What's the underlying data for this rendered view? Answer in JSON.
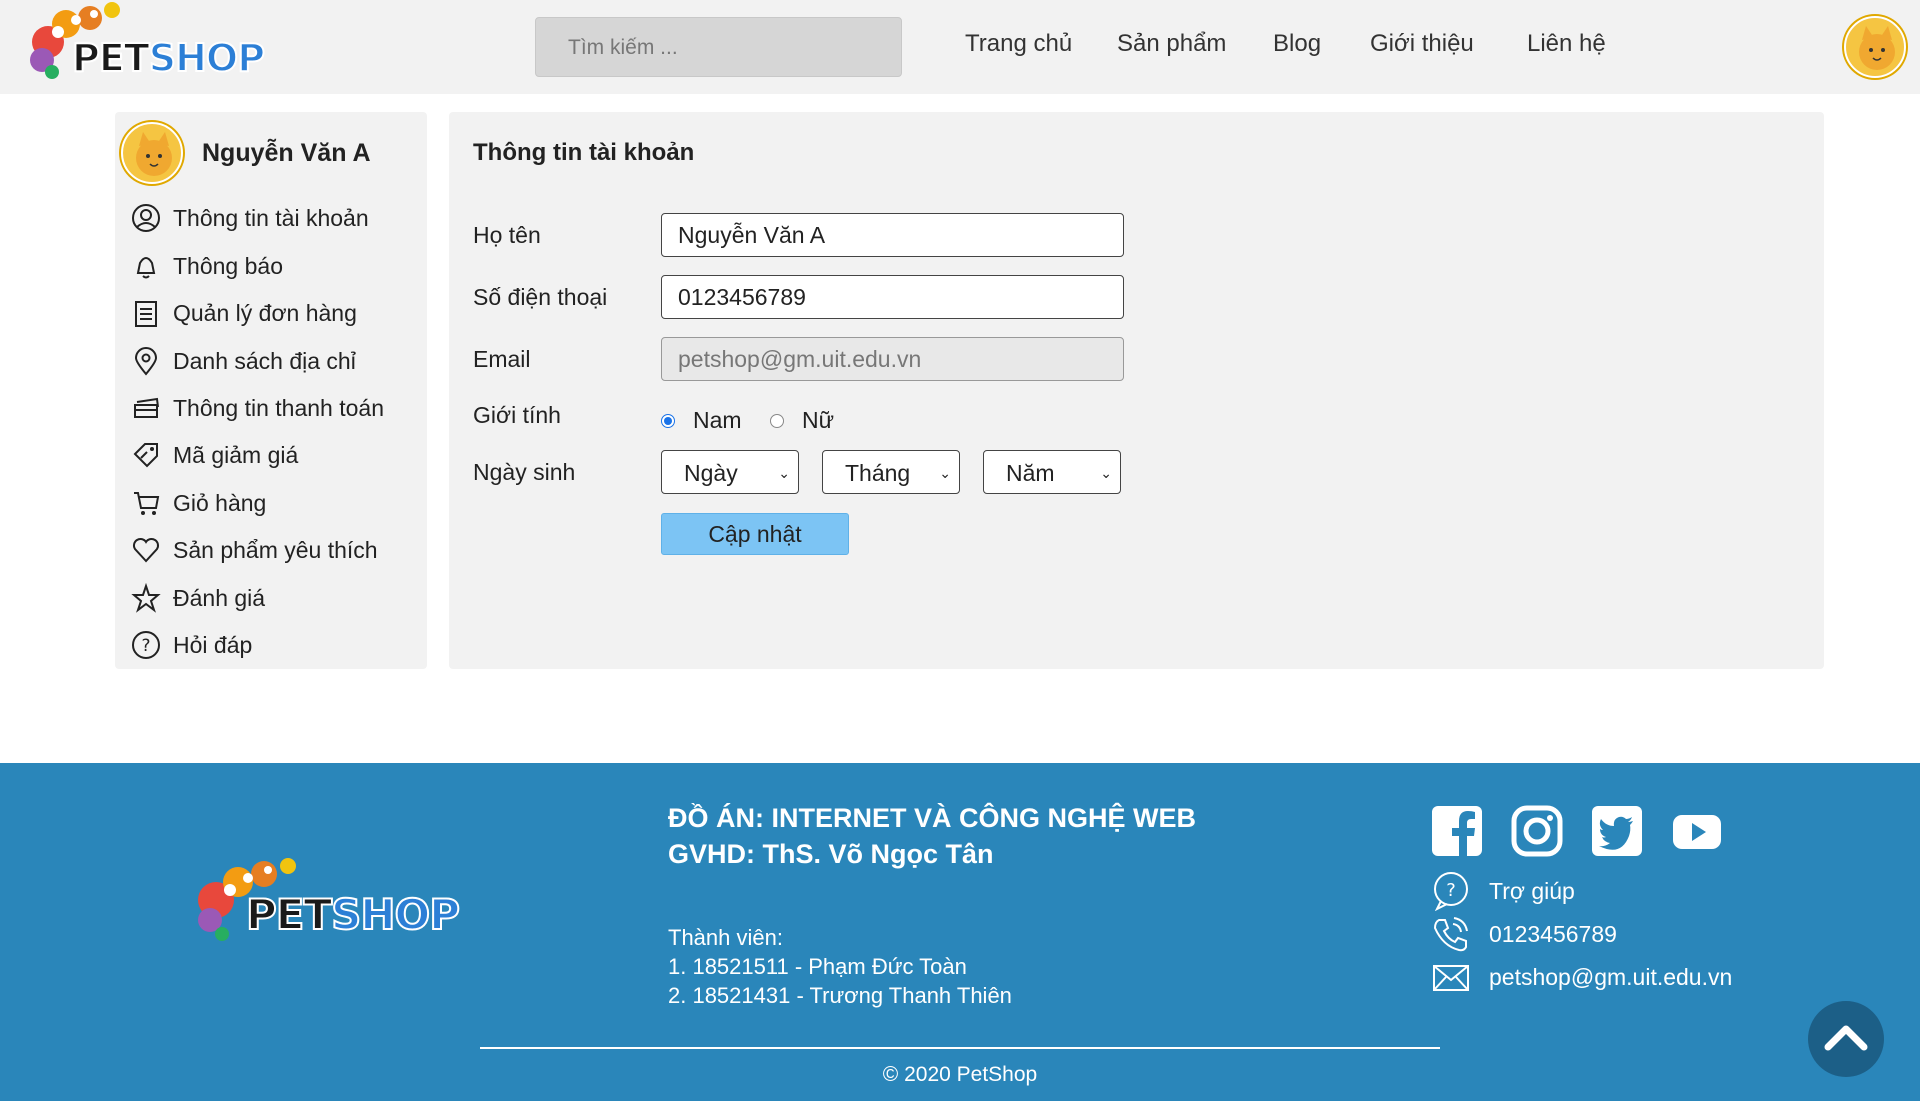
{
  "header": {
    "logo_text_pet": "PET",
    "logo_text_shop": "SHOP",
    "search_placeholder": "Tìm kiếm ...",
    "nav": [
      "Trang chủ",
      "Sản phẩm",
      "Blog",
      "Giới thiệu",
      "Liên hệ"
    ]
  },
  "sidebar": {
    "user_name": "Nguyễn Văn A",
    "items": [
      {
        "label": "Thông tin tài khoản",
        "icon": "user-icon"
      },
      {
        "label": "Thông báo",
        "icon": "bell-icon"
      },
      {
        "label": "Quản lý đơn hàng",
        "icon": "clipboard-icon"
      },
      {
        "label": "Danh sách địa chỉ",
        "icon": "location-pin-icon"
      },
      {
        "label": "Thông tin thanh toán",
        "icon": "credit-card-icon"
      },
      {
        "label": "Mã giảm giá",
        "icon": "coupon-icon"
      },
      {
        "label": "Giỏ hàng",
        "icon": "cart-icon"
      },
      {
        "label": "Sản phẩm yêu thích",
        "icon": "heart-icon"
      },
      {
        "label": "Đánh giá",
        "icon": "star-icon"
      },
      {
        "label": "Hỏi đáp",
        "icon": "question-icon"
      }
    ]
  },
  "form": {
    "title": "Thông tin tài khoản",
    "name_label": "Họ tên",
    "name_value": "Nguyễn Văn A",
    "phone_label": "Số điện thoại",
    "phone_value": "0123456789",
    "email_label": "Email",
    "email_value": "petshop@gm.uit.edu.vn",
    "gender_label": "Giới tính",
    "gender_male": "Nam",
    "gender_female": "Nữ",
    "gender_selected": "Nam",
    "dob_label": "Ngày sinh",
    "dob_day": "Ngày",
    "dob_month": "Tháng",
    "dob_year": "Năm",
    "update_button": "Cập nhật"
  },
  "footer": {
    "title_line1": "ĐỒ ÁN: INTERNET VÀ CÔNG NGHỆ WEB",
    "title_line2": "GVHD: ThS. Võ Ngọc Tân",
    "members_label": "Thành viên:",
    "member1": "1. 18521511 - Phạm Đức Toàn",
    "member2": "2. 18521431 - Trương Thanh Thiên",
    "help": "Trợ giúp",
    "phone": "0123456789",
    "email": "petshop@gm.uit.edu.vn",
    "copyright": "© 2020 PetShop",
    "social": [
      "facebook-icon",
      "instagram-icon",
      "twitter-icon",
      "youtube-icon"
    ]
  },
  "colors": {
    "footer_bg": "#2a86ba",
    "button_bg": "#7cc4f4",
    "panel_bg": "#f2f2f2"
  }
}
